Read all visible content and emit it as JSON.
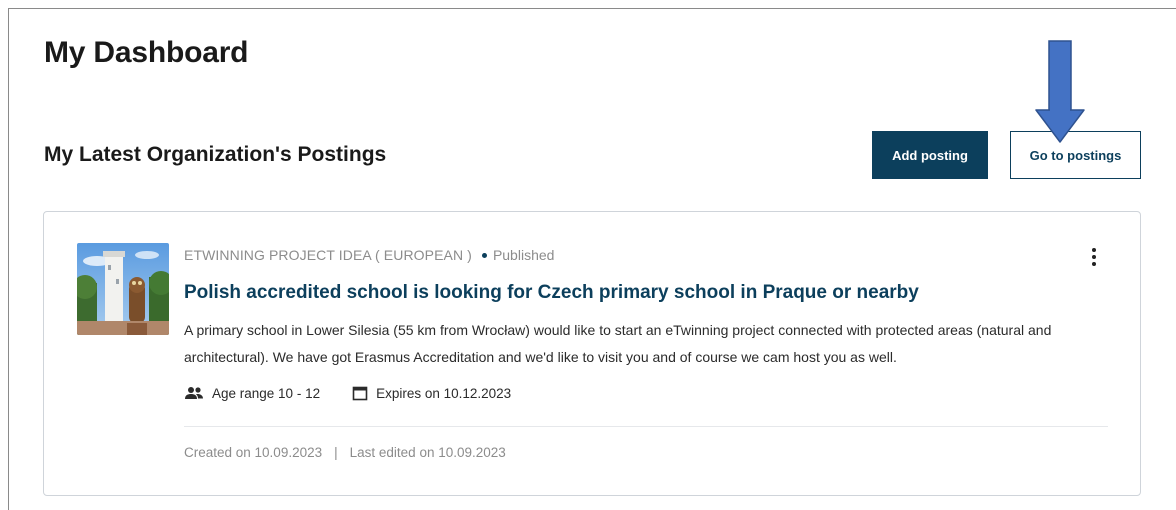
{
  "page": {
    "title": "My Dashboard",
    "section_title": "My Latest Organization's Postings"
  },
  "actions": {
    "add_label": "Add posting",
    "go_label": "Go to postings"
  },
  "posting": {
    "type": "ETWINNING PROJECT IDEA ( EUROPEAN )",
    "status": "Published",
    "title": "Polish accredited school is looking for Czech primary school in Praque or nearby",
    "description": "A primary school in Lower Silesia (55 km from Wrocław) would like to start an eTwinning project connected with protected areas (natural and architectural). We have got Erasmus Accreditation and we'd like to visit you and of course we cam host you as well.",
    "age_range": "Age range 10 - 12",
    "expires": "Expires on 10.12.2023",
    "created": "Created on 10.09.2023",
    "separator": "|",
    "edited": "Last edited on 10.09.2023"
  },
  "icons": {
    "people": "people-icon",
    "calendar": "calendar-icon",
    "menu": "more-vertical-icon",
    "annotation": "down-arrow-icon"
  },
  "colors": {
    "primary": "#0c3f5c",
    "arrow": "#4472c4",
    "muted": "#8c8c8c"
  }
}
